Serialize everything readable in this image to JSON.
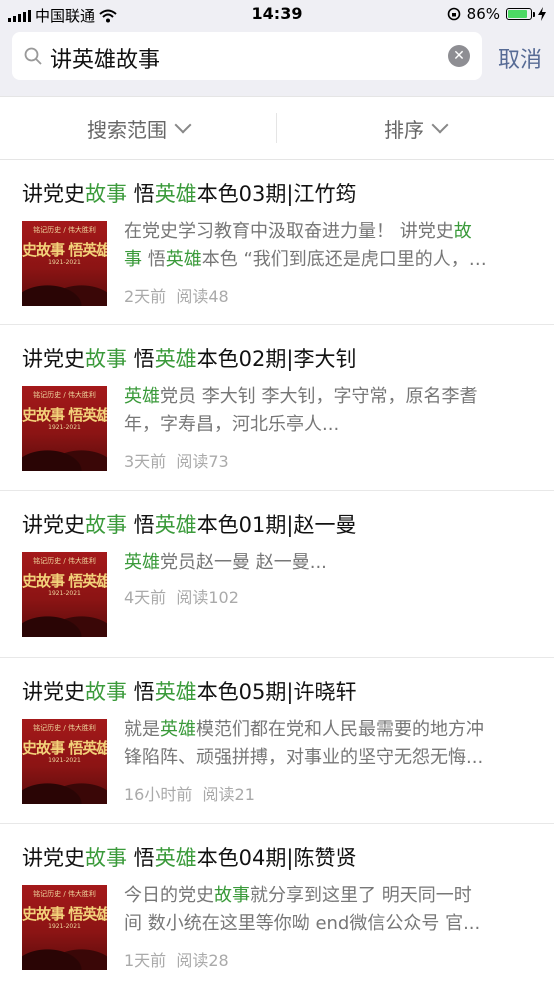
{
  "status": {
    "carrier": "中国联通",
    "time": "14:39",
    "battery": "86%"
  },
  "search": {
    "query": "讲英雄故事",
    "cancel_label": "取消"
  },
  "filters": {
    "scope_label": "搜索范围",
    "sort_label": "排序"
  },
  "thumb": {
    "top_text": "铭记历史 / 伟大胜利",
    "main_text": "史故事 悟英雄",
    "years": "1921-2021"
  },
  "results": [
    {
      "title": [
        "讲党史",
        "故事",
        " 悟",
        "英雄",
        "本色03期|江竹筠"
      ],
      "desc_line1": [
        "在党史学习教育中汲取奋进力量！ 讲党史",
        "故"
      ],
      "desc_line2": [
        "事",
        " 悟",
        "英雄",
        "本色 “我们到底还是虎口里的人，…"
      ],
      "time": "2天前",
      "reads": "阅读48"
    },
    {
      "title": [
        "讲党史",
        "故事",
        " 悟",
        "英雄",
        "本色02期|李大钊"
      ],
      "desc_line1": [
        "",
        "",
        "",
        "英雄",
        "党员 李大钊 李大钊，字守常，原名李耆"
      ],
      "desc_line2": [
        "年，字寿昌，河北乐亭人..."
      ],
      "time": "3天前",
      "reads": "阅读73"
    },
    {
      "title": [
        "讲党史",
        "故事",
        " 悟",
        "英雄",
        "本色01期|赵一曼"
      ],
      "desc_line1": [
        "",
        "",
        "",
        "英雄",
        "党员赵一曼 赵一曼..."
      ],
      "time": "4天前",
      "reads": "阅读102"
    },
    {
      "title": [
        "讲党史",
        "故事",
        " 悟",
        "英雄",
        "本色05期|许晓轩"
      ],
      "desc_line1": [
        "就是",
        "",
        "",
        "英雄",
        "模范们都在党和人民最需要的地方冲"
      ],
      "desc_line2": [
        "锋陷阵、顽强拼搏，对事业的坚守无怨无悔..."
      ],
      "time": "16小时前",
      "reads": "阅读21"
    },
    {
      "title": [
        "讲党史",
        "故事",
        " 悟",
        "英雄",
        "本色04期|陈赞贤"
      ],
      "desc_line1": [
        "今日的党史",
        "故事",
        "就分享到这里了 明天同一时"
      ],
      "desc_line2": [
        "间 数小统在这里等你呦 end微信公众号 官..."
      ],
      "time": "1天前",
      "reads": "阅读28"
    }
  ]
}
